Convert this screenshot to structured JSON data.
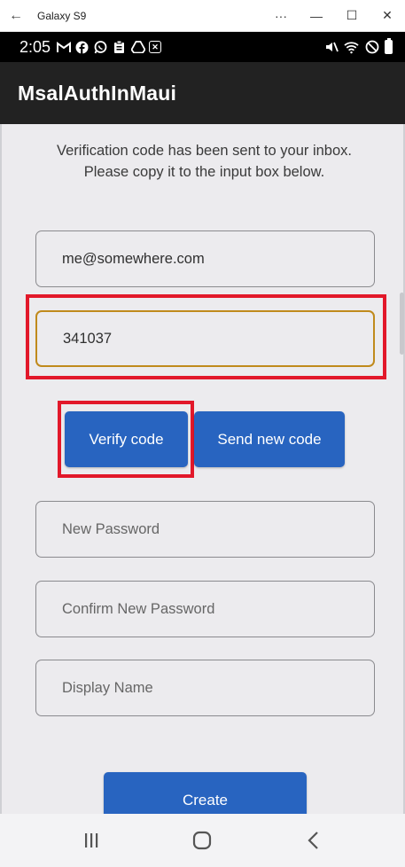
{
  "window": {
    "title": "Galaxy S9",
    "back_glyph": "←",
    "menu_glyph": "···",
    "minimize_glyph": "—",
    "maximize_glyph": "☐",
    "close_glyph": "✕"
  },
  "status_bar": {
    "time": "2:05",
    "left_icons": [
      "gmail-icon",
      "facebook-icon",
      "whatsapp-icon",
      "clipboard-icon",
      "drive-icon",
      "close-box-icon"
    ],
    "right_icons": [
      "mute-icon",
      "wifi-icon",
      "do-not-disturb-icon",
      "battery-icon"
    ]
  },
  "app": {
    "title": "MsalAuthInMaui"
  },
  "form": {
    "info_line1": "Verification code has been sent to your inbox.",
    "info_line2": "Please copy it to the input box below.",
    "email_value": "me@somewhere.com",
    "code_value": "341037",
    "verify_label": "Verify code",
    "send_new_label": "Send new code",
    "new_password_placeholder": "New Password",
    "confirm_password_placeholder": "Confirm New Password",
    "display_name_placeholder": "Display Name",
    "create_label": "Create"
  },
  "colors": {
    "app_bar": "#222222",
    "content_bg": "#ecebee",
    "button": "#2864c0",
    "focus_border": "#c08a1c",
    "annotation": "#e2182a"
  }
}
